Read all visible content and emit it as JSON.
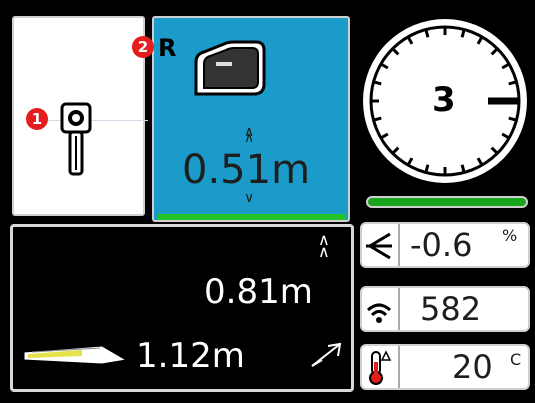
{
  "left_panel": {
    "badge": "1"
  },
  "center_panel": {
    "badge": "2",
    "mode_letter": "R",
    "depth_value": "0.51m"
  },
  "bottom_panel": {
    "depth_value": "0.81m",
    "distance_value": "1.12m"
  },
  "compass": {
    "value": "3"
  },
  "status": {
    "pitch": {
      "value": "-0.6",
      "unit": "%"
    },
    "signal": {
      "value": "582"
    },
    "temperature": {
      "value": "20",
      "unit": "C"
    }
  },
  "colors": {
    "accent_blue": "#1a9bc9",
    "ok_green": "#25c22a",
    "badge_red": "#e51d1d"
  },
  "icons": [
    "probe-icon",
    "receiver-icon",
    "up-arrow-icon",
    "down-arrow-icon",
    "pitch-icon",
    "wifi-signal-icon",
    "thermometer-icon",
    "drill-string-icon"
  ]
}
